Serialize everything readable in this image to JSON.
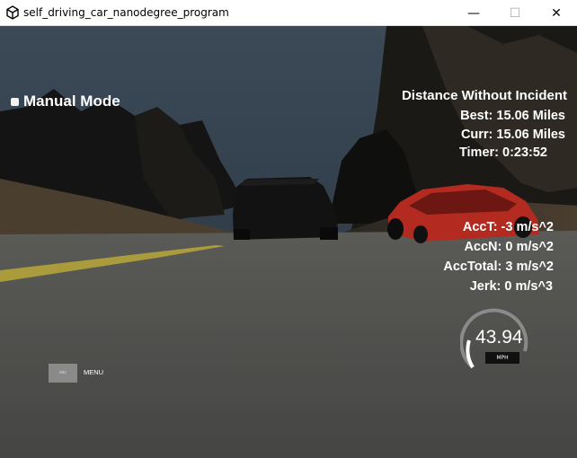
{
  "window": {
    "title": "self_driving_car_nanodegree_program",
    "minimize_label": "—",
    "maximize_label": "☐",
    "close_label": "✕"
  },
  "hud": {
    "manual_mode_label": "Manual Mode",
    "distance_title": "Distance Without Incident",
    "best": "Best: 15.06 Miles",
    "curr": "Curr: 15.06 Miles",
    "timer": "Timer: 0:23:52",
    "acc_t": "AccT: -3 m/s^2",
    "acc_n": "AccN: 0 m/s^2",
    "acc_total": "AccTotal: 3 m/s^2",
    "jerk": "Jerk: 0 m/s^3",
    "speed": "43.94",
    "speed_unit": "MPH",
    "esc_label": "esc",
    "menu_label": "MENU"
  },
  "colors": {
    "sky": "#2f3b47",
    "road": "#4e4e4c",
    "lane": "#c9b43a",
    "red_car": "#b8241c",
    "dark_car": "#121212"
  },
  "icons": {
    "app": "unity-logo-icon",
    "minimize": "minimize-icon",
    "maximize": "maximize-icon",
    "close": "close-icon"
  }
}
